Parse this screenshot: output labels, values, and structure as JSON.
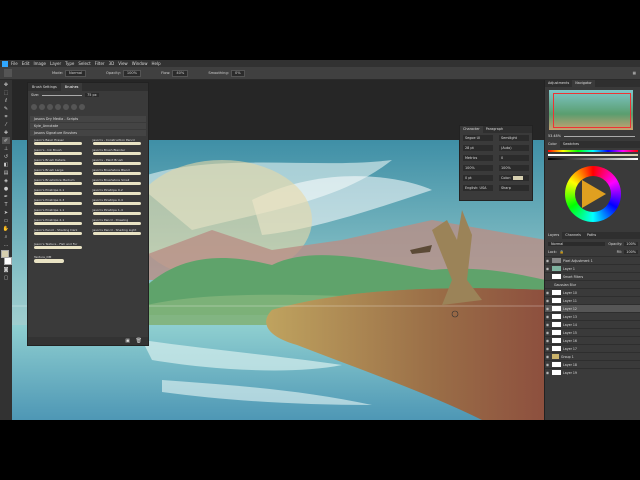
{
  "menu": [
    "File",
    "Edit",
    "Image",
    "Layer",
    "Type",
    "Select",
    "Filter",
    "3D",
    "View",
    "Window",
    "Help"
  ],
  "options": {
    "mode_label": "Mode:",
    "mode_value": "Normal",
    "opacity_label": "Opacity:",
    "opacity_value": "100%",
    "flow_label": "Flow:",
    "flow_value": "40%",
    "smoothing_label": "Smoothing:",
    "smoothing_value": "0%"
  },
  "brush_panel": {
    "tabs": [
      "Brush Settings",
      "Brushes"
    ],
    "size_label": "Size:",
    "size_value": "75 px",
    "folders": [
      "Jasons Dry Media - Scripts",
      "Kyle_Annotate",
      "Jasons Signature Brushes"
    ],
    "brushes": [
      "Jason's Basic Eraser",
      "Jason's - Construction Pencil",
      "Jason's - Ink Brush",
      "Jason's Brush Blender",
      "Jason's Brush Details",
      "Jason's - Paint Brush",
      "Jason's Brush Large",
      "Jason's Brushstore Blend",
      "Jason's Brushstore Medium",
      "Jason's Brushstore Small",
      "Jason's Pinstripe 0-1",
      "Jason's Pinstripe 0-2",
      "Jason's Pinstripe 0-3",
      "Jason's Pinstripe 0-4",
      "Jason's Pinstripe 1-1",
      "Jason's Pinstripe 1-4",
      "Jason's Pinstripe 2-1",
      "Jason's Pencil - Drawing",
      "Jason's Pencil - Shading Dark",
      "Jason's Pencil - Shading Light"
    ],
    "extra": [
      "Jason's Texture - Fish and Fur",
      "Texture_DM"
    ]
  },
  "char_panel": {
    "tabs": [
      "Character",
      "Paragraph"
    ],
    "font": "Segoe UI",
    "style": "Semilight",
    "size": "28 pt",
    "leading": "(Auto)",
    "tracking": "Metrics",
    "kern": "0",
    "scale_v": "100%",
    "scale_h": "100%",
    "baseline": "0 pt",
    "color_label": "Color:",
    "language": "English: USA",
    "aa": "Sharp"
  },
  "right": {
    "nav_tabs": [
      "Adjustments",
      "Navigator"
    ],
    "zoom": "53.48%",
    "color_tabs": [
      "Color",
      "Swatches"
    ],
    "layer_tabs": [
      "Layers",
      "Channels",
      "Paths"
    ],
    "blend": "Normal",
    "opacity_label": "Opacity:",
    "opacity": "100%",
    "lock_label": "Lock:",
    "fill_label": "Fill:",
    "fill": "100%",
    "layers": [
      "Pixel Adjustment 1",
      "Layer 1",
      "Smart Filters",
      "Gaussian Blur",
      "Layer 10",
      "Layer 11",
      "Layer 12",
      "Layer 13",
      "Layer 14",
      "Layer 15",
      "Layer 16",
      "Layer 17",
      "Group 1",
      "Layer 18",
      "Layer 19"
    ]
  },
  "colors": {
    "accent": "#31a8ff"
  }
}
